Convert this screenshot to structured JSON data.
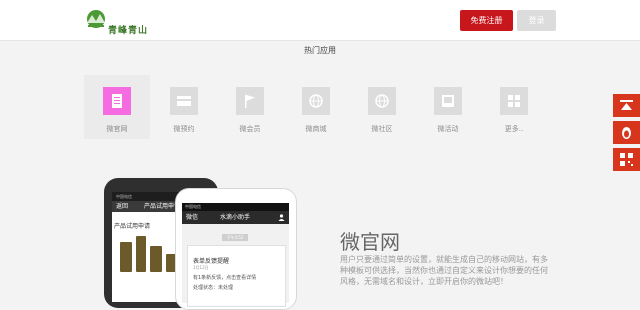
{
  "header": {
    "logo_text": "青峰青山",
    "register_label": "免费注册",
    "login_label": "登录"
  },
  "section_title": "热门应用",
  "apps": [
    {
      "label": "微官网",
      "icon": "document-icon"
    },
    {
      "label": "微预约",
      "icon": "card-icon"
    },
    {
      "label": "微会员",
      "icon": "flag-icon"
    },
    {
      "label": "微商城",
      "icon": "globe-icon"
    },
    {
      "label": "微社区",
      "icon": "globe-icon"
    },
    {
      "label": "微活动",
      "icon": "screen-icon"
    },
    {
      "label": "更多..",
      "icon": "grid-icon"
    }
  ],
  "phone_back": {
    "status": "中国电信",
    "back": "返回",
    "title": "产品试用申请",
    "subtitle": "产品试用申请"
  },
  "phone_front": {
    "status": "中国电信",
    "back": "微信",
    "title": "水滴小助手",
    "time_badge": "下午3:52",
    "card_title": "表单反馈提醒",
    "card_date": "3月12日",
    "card_desc": "有1条新反馈，点击查看详情",
    "card_status": "处理状态：未处理"
  },
  "feature": {
    "title": "微官网",
    "description": "用户只要通过简单的设置，就能生成自己的移动网站，有多种模板可供选择，当然你也通过自定义来设计你想要的任何风格，无需域名和设计，立即开启你的微站吧！"
  },
  "colors": {
    "brand_red": "#c8161d",
    "active_tile": "#f56be0",
    "float_bar": "#d7351c"
  }
}
